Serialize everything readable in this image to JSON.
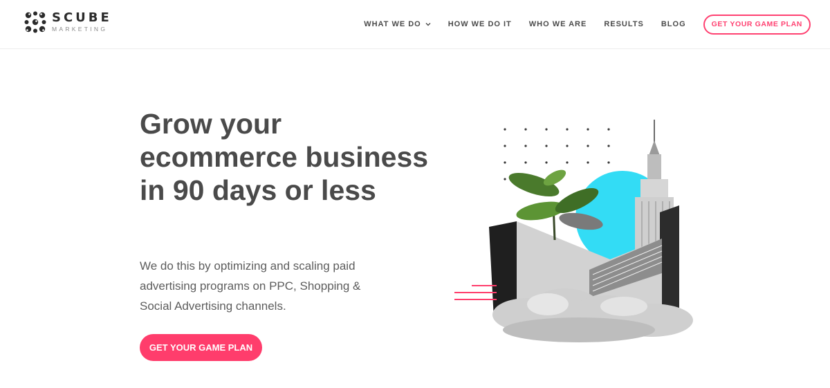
{
  "brand": {
    "name": "SCUBE",
    "sub": "MARKETING"
  },
  "nav": {
    "items": [
      {
        "label": "WHAT WE DO",
        "has_dropdown": true
      },
      {
        "label": "HOW WE DO IT"
      },
      {
        "label": "WHO WE ARE"
      },
      {
        "label": "RESULTS"
      },
      {
        "label": "BLOG"
      }
    ],
    "cta": "GET YOUR GAME PLAN"
  },
  "hero": {
    "title": "Grow your ecommerce business in 90 days or less",
    "subtitle": "We do this by optimizing and scaling paid advertising programs on PPC, Shopping & Social Advertising channels.",
    "cta": "GET YOUR GAME PLAN"
  },
  "colors": {
    "accent": "#ff3d6c",
    "cyan": "#33dcf5",
    "text": "#4a4a4a"
  },
  "icons": {
    "logo": "scube-logo-icon",
    "dropdown": "chevron-down-icon"
  }
}
